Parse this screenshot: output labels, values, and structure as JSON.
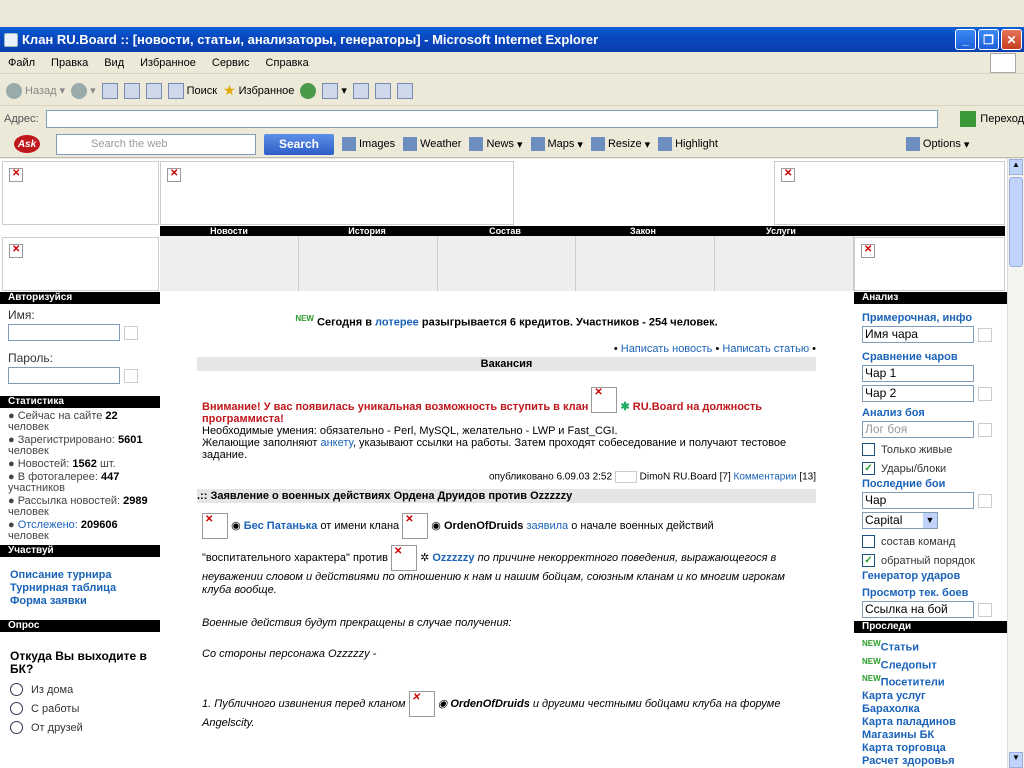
{
  "window": {
    "title": "Клан RU.Board :: [новости, статьи, анализаторы, генераторы] - Microsoft Internet Explorer"
  },
  "menu": [
    "Файл",
    "Правка",
    "Вид",
    "Избранное",
    "Сервис",
    "Справка"
  ],
  "toolbar": {
    "back": "Назад",
    "search": "Поиск",
    "favorites": "Избранное"
  },
  "address": {
    "label": "Адрес:",
    "value": "",
    "go": "Переход"
  },
  "askbar": {
    "logo": "Ask",
    "placeholder": "Search the web",
    "search_btn": "Search",
    "images": "Images",
    "weather": "Weather",
    "news": "News",
    "maps": "Maps",
    "resize": "Resize",
    "highlight": "Highlight",
    "options": "Options"
  },
  "nav": [
    "Новости",
    "История",
    "Состав",
    "Закон",
    "Услуги"
  ],
  "left": {
    "auth_header": "Авторизуйся",
    "name_label": "Имя:",
    "pass_label": "Пароль:",
    "stats_header": "Статистика",
    "stats": [
      {
        "text": "Сейчас на сайте",
        "value": "22",
        "suffix": "человек"
      },
      {
        "text": "Зарегистрировано:",
        "value": "5601",
        "suffix": "человек"
      },
      {
        "text": "Новостей:",
        "value": "1562",
        "suffix": "шт."
      },
      {
        "text": "В фотогалерее:",
        "value": "447",
        "suffix": "участников"
      },
      {
        "text": "Рассылка новостей:",
        "value": "2989",
        "suffix": "человек"
      },
      {
        "text": "Отслежено:",
        "value": "209606",
        "suffix": "человек"
      }
    ],
    "part_header": "Участвуй",
    "part_links": [
      "Описание турнира",
      "Турнирная таблица",
      "Форма заявки"
    ],
    "poll_header": "Опрос",
    "poll_question": "Откуда Вы выходите в БК?",
    "poll_options": [
      "Из дома",
      "С работы",
      "От друзей"
    ]
  },
  "right": {
    "analysis_header": "Анализ",
    "approx": "Примерочная, инфо",
    "char_name": "Имя чара",
    "compare": "Сравнение чаров",
    "char1": "Чар 1",
    "char2": "Чар 2",
    "battle_analysis": "Анализ боя",
    "battle_log": "Лог боя",
    "only_alive": "Только живые",
    "hits_blocks": "Удары/блоки",
    "last_battles": "Последние бои",
    "char": "Чар",
    "capital": "Capital",
    "team_comp": "состав команд",
    "reverse": "обратный порядок",
    "hit_gen": "Генератор ударов",
    "view_battles": "Просмотр тек. боев",
    "battle_link": "Ссылка на бой",
    "track_header": "Проследи",
    "track_links": [
      "Статьи",
      "Следопыт",
      "Посетители"
    ],
    "more_links": [
      "Карта услуг",
      "Барахолка",
      "Карта паладинов",
      "Магазины БК",
      "Карта торговца",
      "Расчет здоровья"
    ]
  },
  "main": {
    "lottery_pre": "Сегодня в",
    "lottery_link": "лотерее",
    "lottery_post": "разыгрывается 6 кредитов. Участников - 254 человек.",
    "write_news": "Написать новость",
    "write_article": "Написать статью",
    "vacancy": "Вакансия",
    "warn": "Внимание! У вас появилась уникальная возможность вступить в клан",
    "clan": "RU.Board",
    "warn_post": "на должность программиста!",
    "skills": "Необходимые умения: обязательно - Perl, MySQL, желательно - LWP и Fast_CGI.",
    "apply_pre": "Желающие заполняют",
    "apply_link": "анкету",
    "apply_post": ", указывают ссылки на работы. Затем проходят собеседование и получают тестовое задание.",
    "published": "опубликовано 6.09.03 2:52",
    "author": "DimoN RU.Board [7]",
    "comments": "Комментарии",
    "comments_count": "[13]",
    "war_title": ".:: Заявление о военных действиях Ордена Друидов против Ozzzzzy",
    "bes": "Бес Патанька",
    "from_clan": "от имени клана",
    "order": "OrdenOfDruids",
    "declared": "заявила",
    "declared_post": "о начале военных действий",
    "vosp": "\"воспитательного характера\" против",
    "ozz": "Ozzzzzy",
    "reason": "по причине некорректного поведения, выражающегося в неуважении словом и действиями по отношению к нам и нашим бойцам, союзным кланам и ко многим игрокам клуба вообще.",
    "stop": "Военные действия будут прекращены в случае получения:",
    "from_char": "Со стороны персонажа Ozzzzzy -",
    "p1_pre": "1. Публичного извинения перед кланом",
    "p1_post": "и другими честными бойцами клуба на форуме Angelscity."
  }
}
